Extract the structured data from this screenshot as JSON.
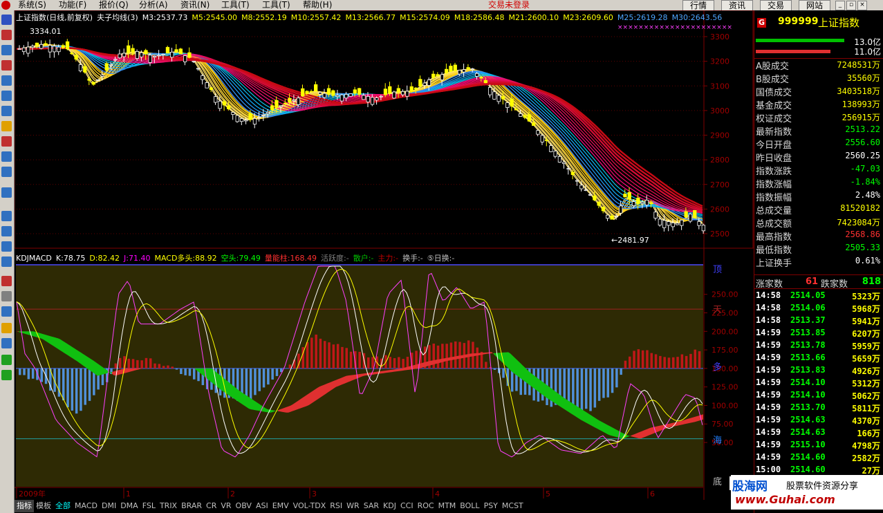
{
  "menu": {
    "items": [
      "系统(S)",
      "功能(F)",
      "报价(Q)",
      "分析(A)",
      "资讯(N)",
      "工具(T)",
      "工具(T)",
      "帮助(H)"
    ],
    "status": "交易未登录",
    "right_buttons": [
      "行情",
      "资讯",
      "交易",
      "网站"
    ]
  },
  "main_chart": {
    "title": "上证指数(日线,前复权)",
    "indicator": "夫子均线(3)",
    "ma_legend": [
      {
        "label": "M3:2537.73",
        "color": "#ffffff"
      },
      {
        "label": "M5:2545.00",
        "color": "#ffff00"
      },
      {
        "label": "M8:2552.19",
        "color": "#ffff00"
      },
      {
        "label": "M10:2557.42",
        "color": "#ffff00"
      },
      {
        "label": "M13:2566.77",
        "color": "#ffff00"
      },
      {
        "label": "M15:2574.09",
        "color": "#ffff00"
      },
      {
        "label": "M18:2586.48",
        "color": "#ffff00"
      },
      {
        "label": "M21:2600.10",
        "color": "#ffff00"
      },
      {
        "label": "M23:2609.60",
        "color": "#ffff00"
      },
      {
        "label": "M25:2619.28",
        "color": "#4da6ff"
      },
      {
        "label": "M30:2643.56",
        "color": "#4da6ff"
      }
    ],
    "high_label": "3334.01",
    "low_label": "←2481.97",
    "y_ticks": [
      "3300",
      "3200",
      "3100",
      "3000",
      "2900",
      "2800",
      "2700",
      "2600",
      "2500"
    ],
    "x_ticks": [
      "2009年",
      "1",
      "2",
      "3",
      "4",
      "5",
      "6"
    ]
  },
  "sub_chart": {
    "name": "KDJMACD",
    "legend": [
      {
        "label": "K:78.75",
        "color": "#ffffff"
      },
      {
        "label": "D:82.42",
        "color": "#ffff00"
      },
      {
        "label": "J:71.40",
        "color": "#ff00ff"
      },
      {
        "label": "MACD多头:88.92",
        "color": "#ffff00"
      },
      {
        "label": "空头:79.49",
        "color": "#00ff00"
      },
      {
        "label": "量能柱:168.49",
        "color": "#ff3030"
      },
      {
        "label": "活跃度:-",
        "color": "#808080"
      },
      {
        "label": "散户:-",
        "color": "#00c000"
      },
      {
        "label": "主力:-",
        "color": "#c00000"
      },
      {
        "label": "换手:-",
        "color": "#c0c0c0"
      },
      {
        "label": "⑤日换:-",
        "color": "#c0c0c0"
      }
    ],
    "zones": [
      "顶",
      "天",
      "多",
      "海",
      "底"
    ],
    "y_ticks": [
      "250.00",
      "225.00",
      "200.00",
      "175.00",
      "150.00",
      "125.00",
      "100.00",
      "75.00",
      "50.00"
    ]
  },
  "right_panel": {
    "code": "999999",
    "name": "上证指数",
    "g_badge": "G",
    "bar1_value": "13.0亿",
    "bar2_value": "11.0亿",
    "stats": [
      {
        "label": "A股成交",
        "value": "7248531万",
        "color": "#ffff00"
      },
      {
        "label": "B股成交",
        "value": "35560万",
        "color": "#ffff00"
      },
      {
        "label": "国债成交",
        "value": "3403518万",
        "color": "#ffff00"
      },
      {
        "label": "基金成交",
        "value": "138993万",
        "color": "#ffff00"
      },
      {
        "label": "权证成交",
        "value": "256915万",
        "color": "#ffff00"
      },
      {
        "label": "最新指数",
        "value": "2513.22",
        "color": "#00ff00"
      },
      {
        "label": "今日开盘",
        "value": "2556.60",
        "color": "#00ff00"
      },
      {
        "label": "昨日收盘",
        "value": "2560.25",
        "color": "#ffffff"
      },
      {
        "label": "指数涨跌",
        "value": "-47.03",
        "color": "#00ff00"
      },
      {
        "label": "指数涨幅",
        "value": "-1.84%",
        "color": "#00ff00"
      },
      {
        "label": "指数振幅",
        "value": "2.48%",
        "color": "#ffffff"
      },
      {
        "label": "总成交量",
        "value": "81520182",
        "color": "#ffff00"
      },
      {
        "label": "总成交额",
        "value": "7423084万",
        "color": "#ffff00"
      },
      {
        "label": "最高指数",
        "value": "2568.86",
        "color": "#ff3030"
      },
      {
        "label": "最低指数",
        "value": "2505.33",
        "color": "#00ff00"
      },
      {
        "label": "上证换手",
        "value": "0.61%",
        "color": "#ffffff"
      }
    ],
    "up_label": "涨家数",
    "up_count": "61",
    "down_label": "跌家数",
    "down_count": "818",
    "ticks": [
      {
        "time": "14:58",
        "price": "2514.05",
        "vol": "5323万"
      },
      {
        "time": "14:58",
        "price": "2514.06",
        "vol": "5968万"
      },
      {
        "time": "14:58",
        "price": "2513.37",
        "vol": "5941万"
      },
      {
        "time": "14:59",
        "price": "2513.85",
        "vol": "6207万"
      },
      {
        "time": "14:59",
        "price": "2513.78",
        "vol": "5959万"
      },
      {
        "time": "14:59",
        "price": "2513.66",
        "vol": "5659万"
      },
      {
        "time": "14:59",
        "price": "2513.83",
        "vol": "4926万"
      },
      {
        "time": "14:59",
        "price": "2514.10",
        "vol": "5312万"
      },
      {
        "time": "14:59",
        "price": "2514.10",
        "vol": "5062万"
      },
      {
        "time": "14:59",
        "price": "2513.70",
        "vol": "5811万"
      },
      {
        "time": "14:59",
        "price": "2514.63",
        "vol": "4370万"
      },
      {
        "time": "14:59",
        "price": "2514.63",
        "vol": "166万"
      },
      {
        "time": "14:59",
        "price": "2515.10",
        "vol": "4798万"
      },
      {
        "time": "14:59",
        "price": "2514.60",
        "vol": "2582万"
      },
      {
        "time": "15:00",
        "price": "2514.60",
        "vol": "27万"
      }
    ]
  },
  "tabs": [
    "指标",
    "模板",
    "全部",
    "MACD",
    "DMI",
    "DMA",
    "FSL",
    "TRIX",
    "BRAR",
    "CR",
    "VR",
    "OBV",
    "ASI",
    "EMV",
    "VOL-TDX",
    "RSI",
    "WR",
    "SAR",
    "KDJ",
    "CCI",
    "ROC",
    "MTM",
    "BOLL",
    "PSY",
    "MCST"
  ],
  "watermark": {
    "brand": "股海网",
    "slogan": "股票软件资源分享",
    "url": "www.Guhai.com"
  }
}
